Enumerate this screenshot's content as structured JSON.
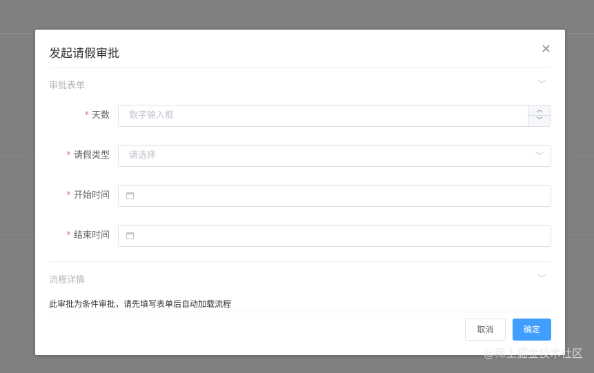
{
  "dialog": {
    "title": "发起请假审批",
    "close_icon": "close-icon"
  },
  "form_section": {
    "title": "审批表单"
  },
  "fields": [
    {
      "label": "天数",
      "required_mark": "*",
      "placeholder": "数字输入框"
    },
    {
      "label": "请假类型",
      "required_mark": "*",
      "placeholder": "请选择"
    },
    {
      "label": "开始时间",
      "required_mark": "*",
      "placeholder": ""
    },
    {
      "label": "结束时间",
      "required_mark": "*",
      "placeholder": ""
    }
  ],
  "flow_section": {
    "title": "流程详情",
    "note": "此审批为条件审批，请先填写表单后自动加载流程"
  },
  "footer": {
    "cancel": "取消",
    "confirm": "确定"
  },
  "watermark": "@稀土掘金技术社区",
  "colors": {
    "primary": "#409eff",
    "required": "#f56c6c"
  }
}
